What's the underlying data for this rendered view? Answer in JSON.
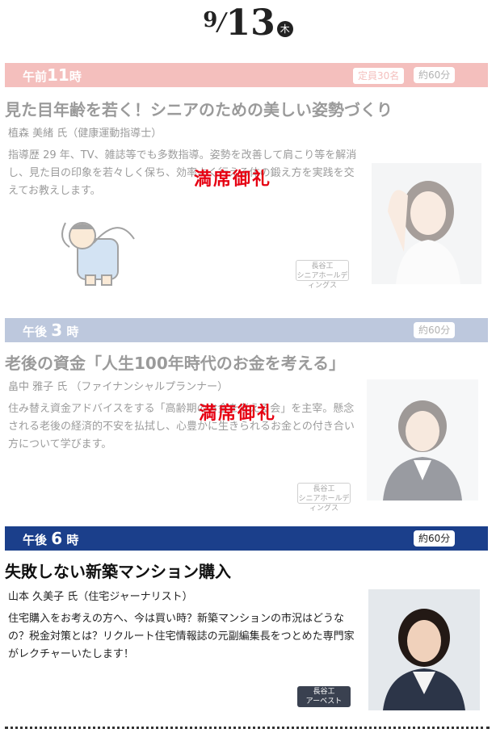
{
  "date": {
    "month": "9",
    "day": "13",
    "weekday": "木"
  },
  "sessions": [
    {
      "time_prefix": "午前",
      "time_num": "11",
      "time_suffix": "時",
      "capacity": "定員30名",
      "duration": "約60分",
      "title": "見た目年齢を若く！シニアのための美しい姿勢づくり",
      "speaker": "植森 美緒 氏（健康運動指導士）",
      "desc": "指導歴 29 年、TV、雑誌等でも多数指導。姿勢を改善して肩こり等を解消し、見た目の印象を若々しく保ち、効率よく行える体の鍛え方を実践を交えてお教えします。",
      "badge": [
        "長谷工",
        "シニアホールディングス"
      ],
      "soldout": "満席御礼",
      "bar_color": "#e8736e"
    },
    {
      "time_prefix": "午後",
      "time_num": "3",
      "time_suffix": "時",
      "duration": "約60分",
      "title": "老後の資金「人生100年時代のお金を考える」",
      "speaker": "畠中 雅子 氏 （ファイナンシャルプランナー）",
      "desc": "住み替え資金アドバイスをする「高齢期のお金を考える会」を主宰。懸念される老後の経済的不安を払拭し、心豊かに生きられるお金との付き合い方について学びます。",
      "badge": [
        "長谷工",
        "シニアホールディングス"
      ],
      "soldout": "満席御礼",
      "bar_color": "#6f86b4"
    },
    {
      "time_prefix": "午後",
      "time_num": "6",
      "time_suffix": "時",
      "duration": "約60分",
      "title": "失敗しない新築マンション購入",
      "speaker": "山本 久美子 氏（住宅ジャーナリスト）",
      "desc": "住宅購入をお考えの方へ、今は買い時？新築マンションの市況はどうなの？税金対策とは？リクルート住宅情報誌の元副編集長をつとめた専門家がレクチャーいたします！",
      "badge": [
        "長谷工",
        "アーベスト"
      ],
      "bar_color": "#1b3f8b"
    }
  ]
}
